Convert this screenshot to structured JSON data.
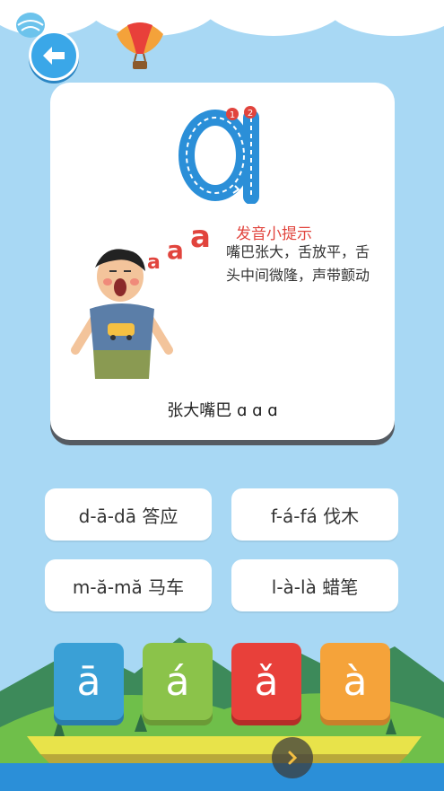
{
  "letter": "a",
  "stroke_numbers": [
    "1",
    "2"
  ],
  "tip": {
    "title": "发音小提示",
    "line1": "嘴巴张大，舌放平，舌",
    "line2": "头中间微隆，声带颤动"
  },
  "sound_marks": [
    "a",
    "a",
    "a"
  ],
  "caption": "张大嘴巴 ɑ ɑ ɑ",
  "words": [
    {
      "label": "d-ā-dā 答应"
    },
    {
      "label": "f-á-fá  伐木"
    },
    {
      "label": "m-ă-mă 马车"
    },
    {
      "label": "l-à-là 蜡笔"
    }
  ],
  "tones": [
    {
      "label": "ā",
      "color": "#3aa0d6"
    },
    {
      "label": "á",
      "color": "#8bc34a"
    },
    {
      "label": "ǎ",
      "color": "#e8403a"
    },
    {
      "label": "à",
      "color": "#f5a33a"
    }
  ],
  "icons": {
    "back": "back-arrow-icon",
    "next": "chevron-right-icon"
  },
  "colors": {
    "sky": "#a8d8f4",
    "accent_blue": "#3aa7e8",
    "tip_red": "#e1443d"
  }
}
